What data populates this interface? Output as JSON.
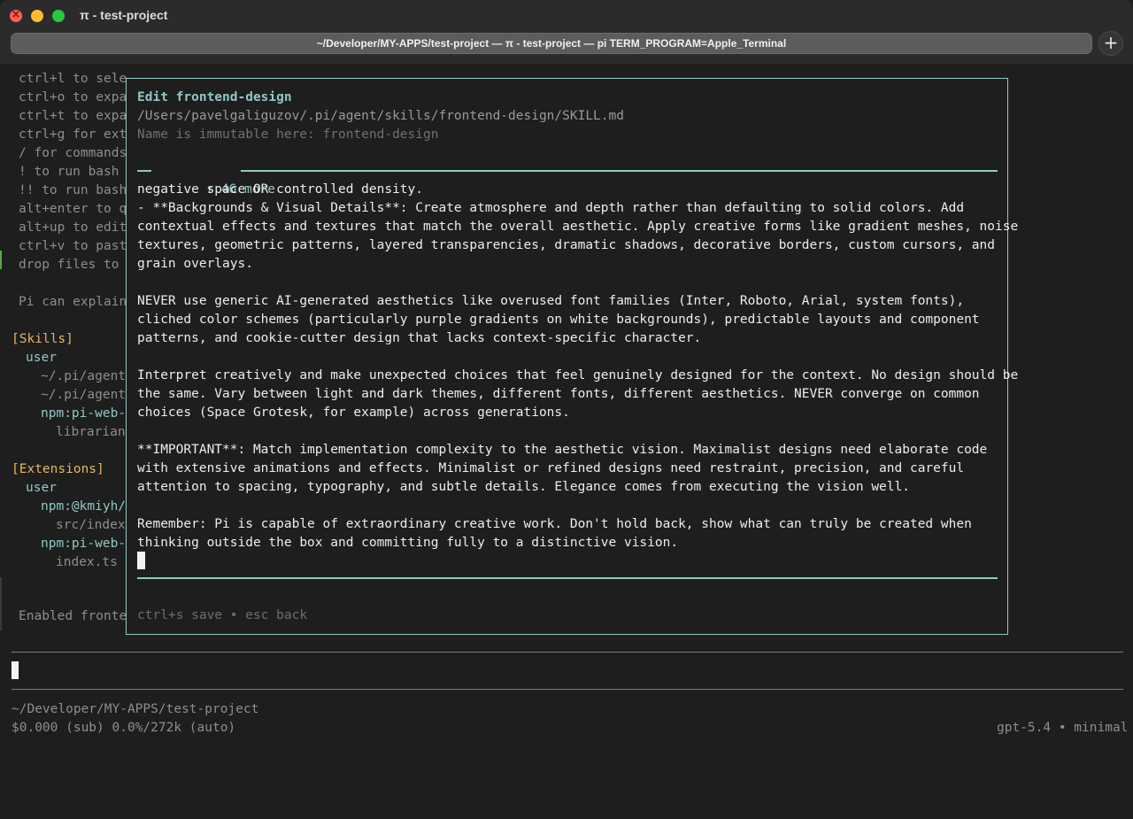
{
  "window": {
    "title": "π - test-project",
    "tab_title": "~/Developer/MY-APPS/test-project — π - test-project — pi TERM_PROGRAM=Apple_Terminal",
    "new_tab_symbol": "+"
  },
  "background": {
    "hints": [
      "ctrl+l to sele",
      "ctrl+o to expa",
      "ctrl+t to expa",
      "ctrl+g for ext",
      "/ for commands",
      "! to run bash",
      "!! to run bash",
      "alt+enter to q",
      "alt+up to edit",
      "ctrl+v to past",
      "drop files to"
    ],
    "explain": "Pi can explain",
    "skills_header": "[Skills]",
    "skills_user": "user",
    "skills_items": [
      "~/.pi/agent",
      "~/.pi/agent",
      "npm:pi-web-",
      "librarian"
    ],
    "extensions_header": "[Extensions]",
    "extensions_user": "user",
    "extensions_items": [
      "npm:@kmiyh/",
      "src/index",
      "npm:pi-web-",
      "index.ts"
    ],
    "enabled": "Enabled fronte"
  },
  "footer": {
    "cwd": "~/Developer/MY-APPS/test-project",
    "usage": "$0.000 (sub) 0.0%/272k (auto)",
    "model": "gpt-5.4 • minimal"
  },
  "modal": {
    "title": "Edit frontend-design",
    "path": "/Users/pavelgaliguzov/.pi/agent/skills/frontend-design/SKILL.md",
    "name_note": "Name is immutable here: frontend-design",
    "more": "↑ 46 more",
    "body_lines": [
      "negative space OR controlled density.",
      "- **Backgrounds & Visual Details**: Create atmosphere and depth rather than defaulting to solid colors. Add",
      "contextual effects and textures that match the overall aesthetic. Apply creative forms like gradient meshes, noise",
      "textures, geometric patterns, layered transparencies, dramatic shadows, decorative borders, custom cursors, and",
      "grain overlays.",
      "",
      "NEVER use generic AI-generated aesthetics like overused font families (Inter, Roboto, Arial, system fonts),",
      "cliched color schemes (particularly purple gradients on white backgrounds), predictable layouts and component",
      "patterns, and cookie-cutter design that lacks context-specific character.",
      "",
      "Interpret creatively and make unexpected choices that feel genuinely designed for the context. No design should be",
      "the same. Vary between light and dark themes, different fonts, different aesthetics. NEVER converge on common",
      "choices (Space Grotesk, for example) across generations.",
      "",
      "**IMPORTANT**: Match implementation complexity to the aesthetic vision. Maximalist designs need elaborate code",
      "with extensive animations and effects. Minimalist or refined designs need restraint, precision, and careful",
      "attention to spacing, typography, and subtle details. Elegance comes from executing the vision well.",
      "",
      "Remember: Pi is capable of extraordinary creative work. Don't hold back, show what can truly be created when",
      "thinking outside the box and committing fully to a distinctive vision."
    ],
    "hint": "ctrl+s save • esc back"
  },
  "colors": {
    "accent": "#8fc9c6",
    "section_header": "#e5b567",
    "background": "#1e1e1e",
    "text": "#ededed"
  }
}
